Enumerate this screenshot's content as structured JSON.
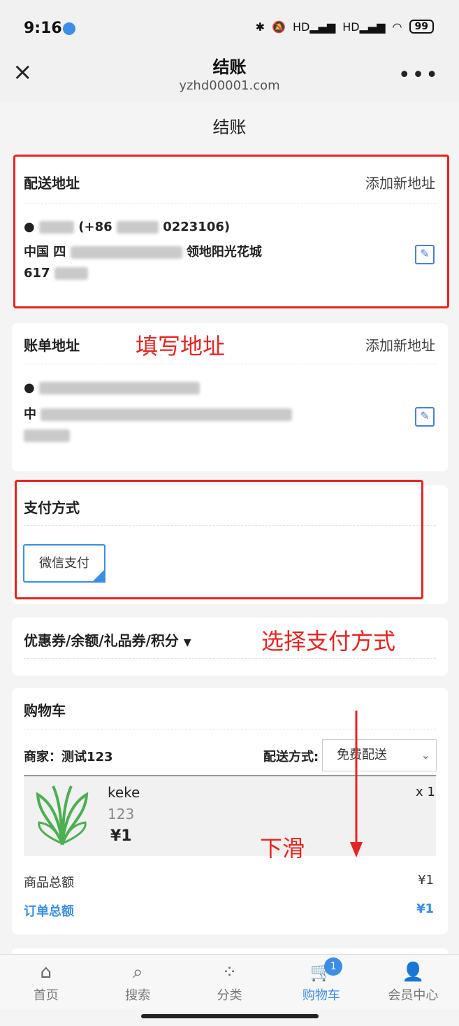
{
  "status": {
    "time": "9:16",
    "battery": "99",
    "signal_labels": [
      "HD",
      "HD"
    ]
  },
  "nav": {
    "title": "结账",
    "subtitle": "yzhd00001.com",
    "close": "×",
    "more": "•••"
  },
  "page": {
    "title": "结账"
  },
  "shipping": {
    "title": "配送地址",
    "action": "添加新地址",
    "name_phone": "(+86",
    "phone_tail": "0223106)",
    "line2": "中国 四",
    "line2_tail": "领地阳光花城",
    "postcode": "617"
  },
  "billing": {
    "title": "账单地址",
    "action": "添加新地址",
    "line1": "",
    "line2": "中",
    "line3": ""
  },
  "payment": {
    "title": "支付方式",
    "method": "微信支付"
  },
  "coupon": {
    "title": "优惠券/余额/礼品券/积分"
  },
  "cart": {
    "title": "购物车",
    "seller_label": "商家：测试123",
    "shipping_method_label": "配送方式:",
    "shipping_method_value": "免费配送",
    "product": {
      "name": "keke",
      "sku": "123",
      "price": "¥1",
      "qty": "x 1"
    },
    "subtotal_label": "商品总额",
    "subtotal_value": "¥1",
    "total_label": "订单总额",
    "total_value": "¥1"
  },
  "annotations": {
    "fill_address": "填写地址",
    "choose_payment": "选择支付方式",
    "scroll_down": "下滑"
  },
  "tabbar": {
    "items": [
      {
        "label": "首页",
        "icon": "home-icon"
      },
      {
        "label": "搜索",
        "icon": "search-icon"
      },
      {
        "label": "分类",
        "icon": "category-icon"
      },
      {
        "label": "购物车",
        "icon": "cart-icon",
        "badge": "1"
      },
      {
        "label": "会员中心",
        "icon": "user-icon"
      }
    ]
  },
  "colors": {
    "accent": "#3a8ee6",
    "annotation_red": "#e52420"
  }
}
